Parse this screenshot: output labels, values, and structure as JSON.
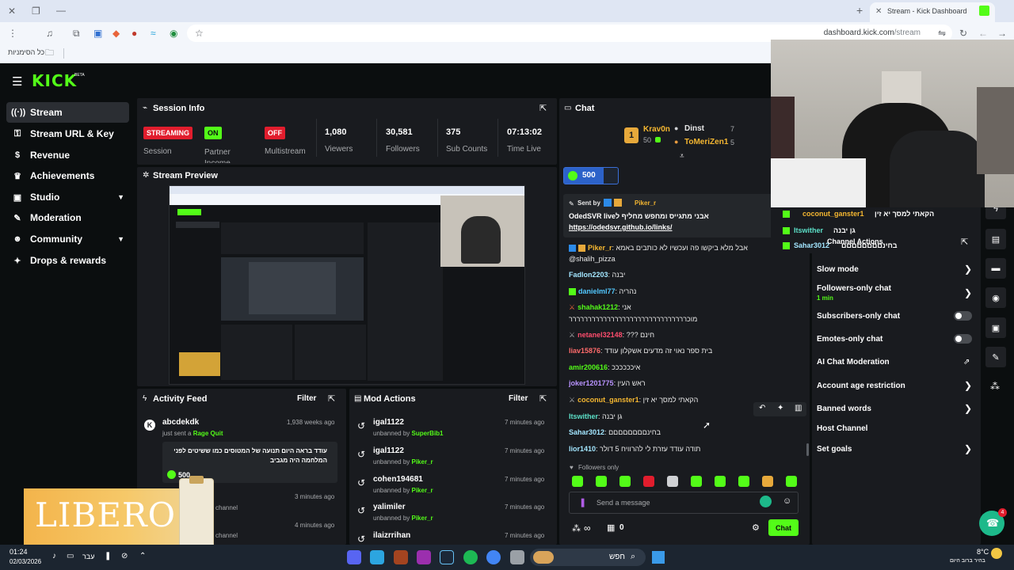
{
  "browser": {
    "tab_title": "Stream - Kick Dashboard",
    "address": "dashboard.kick.com/stream",
    "address_domain": "dashboard.kick.com",
    "address_path": "/stream",
    "bookmarks_label": "כל הסימניות"
  },
  "brand": {
    "logo": "KICK",
    "beta": "BETA",
    "accent": "#53fc18"
  },
  "sidebar": {
    "items": [
      {
        "label": "Stream",
        "icon": "broadcast-icon",
        "active": true
      },
      {
        "label": "Stream URL & Key",
        "icon": "key-icon"
      },
      {
        "label": "Revenue",
        "icon": "dollar-icon"
      },
      {
        "label": "Achievements",
        "icon": "trophy-icon"
      },
      {
        "label": "Studio",
        "icon": "camera-icon",
        "expandable": true
      },
      {
        "label": "Moderation",
        "icon": "wrench-icon"
      },
      {
        "label": "Community",
        "icon": "people-icon",
        "expandable": true
      },
      {
        "label": "Drops & rewards",
        "icon": "gift-icon"
      }
    ]
  },
  "session": {
    "title": "Session Info",
    "badges": [
      {
        "status": "STREAMING",
        "label": "Session"
      },
      {
        "status": "ON",
        "label": "Partner Income"
      },
      {
        "status": "OFF",
        "label": "Multistream"
      }
    ],
    "stats": [
      {
        "value": "1,080",
        "label": "Viewers"
      },
      {
        "value": "30,581",
        "label": "Followers"
      },
      {
        "value": "375",
        "label": "Sub Counts"
      },
      {
        "value": "07:13:02",
        "label": "Time Live"
      }
    ]
  },
  "preview": {
    "title": "Stream Preview"
  },
  "activity": {
    "title": "Activity Feed",
    "filter": "Filter",
    "items": [
      {
        "user": "abcdekdk",
        "time": "1,938 weeks ago",
        "action": "just sent a",
        "highlight": "Rage Quit",
        "message": "עודד בראה היום תנועה של המטוסים כמו ששיטים לפני המלחמה היה מגביב",
        "amount": "500"
      },
      {
        "time": "3 minutes ago",
        "text": "channel"
      },
      {
        "time": "4 minutes ago",
        "text": "channel"
      }
    ]
  },
  "mod_actions": {
    "title": "Mod Actions",
    "filter": "Filter",
    "items": [
      {
        "user": "igal1122",
        "action": "unbanned by",
        "by": "SuperBib1",
        "time": "7 minutes ago"
      },
      {
        "user": "igal1122",
        "action": "unbanned by",
        "by": "Piker_r",
        "time": "7 minutes ago"
      },
      {
        "user": "cohen194681",
        "action": "unbanned by",
        "by": "Piker_r",
        "time": "7 minutes ago"
      },
      {
        "user": "yalimiler",
        "action": "unbanned by",
        "by": "Piker_r",
        "time": "7 minutes ago"
      },
      {
        "user": "ilaizrrihan",
        "action": "",
        "by": "",
        "time": "7 minutes ago"
      }
    ]
  },
  "chat": {
    "title": "Chat",
    "leaders": [
      {
        "rank": "1",
        "name": "Krav0n",
        "count": "50"
      },
      {
        "name": "Dinst",
        "count": "7"
      },
      {
        "name": "ToMeriZen1",
        "count": "5"
      }
    ],
    "kicks": "500",
    "pinned": {
      "sent_by_label": "Sent by",
      "sender": "Piker_r",
      "text": "OdedSVR liveאבני מתגייס ומחפש מחליף ל",
      "link": "https://odedsvr.github.io/links/"
    },
    "messages": [
      {
        "user": "Piker_r",
        "text": "אבל מלא ביקשו פה ועכשיו לא כותבים באמא",
        "color": "#f5b731"
      },
      {
        "user": "",
        "text": "@shalih_pizza",
        "color": "#e8e8e8"
      },
      {
        "user": "Fadlon2203",
        "text": "יבנה",
        "color": "#a3e6ff"
      },
      {
        "user": "danielml77",
        "text": "נהריה",
        "color": "#52c8ff"
      },
      {
        "user": "shahak1212",
        "text": "אני",
        "color": "#53fc18"
      },
      {
        "user": "",
        "text": "מוכררררררררררררררררררררררררררררררר",
        "color": "#e8e8e8"
      },
      {
        "user": "netanel32148",
        "text": "??? חינם",
        "color": "#ff4d6d"
      },
      {
        "user": "liav15876",
        "text": "בית ספר נאוי זה מדעים אשקלון עודד",
        "color": "#ff6b6b"
      },
      {
        "user": "amir200616",
        "text": "איככככככ",
        "color": "#53fc18"
      },
      {
        "user": "joker1201775",
        "text": "ראש העין",
        "color": "#b993ff"
      },
      {
        "user": "coconut_ganster1",
        "text": "הקאתי למסך יא זין",
        "color": "#f5b731"
      },
      {
        "user": "Itswither",
        "text": "גן יבנה",
        "color": "#5ce0c8"
      },
      {
        "user": "Sahar3012",
        "text": "בחינםםםםםםםם",
        "color": "#a3e6ff"
      },
      {
        "user": "lior1410",
        "text": "תודה עודד עזרת לי להרוויח 5 דולר",
        "color": "#a3e6ff"
      }
    ],
    "mode_note": "Followers only",
    "placeholder": "Send a message",
    "footer_count": "0",
    "send_label": "Chat"
  },
  "channel_actions": {
    "title": "Channel Actions",
    "overlay": [
      {
        "user": "coconut_ganster1",
        "text": "הקאתי למסך יא זין"
      },
      {
        "user": "Itswither",
        "text": "גן יבנה"
      },
      {
        "user": "Sahar3012",
        "text": "בחינםםםםםםםם"
      }
    ],
    "rows": [
      {
        "label": "Slow mode",
        "control": "chevron"
      },
      {
        "label": "Followers-only chat",
        "sub": "1 min",
        "control": "chevron"
      },
      {
        "label": "Subscribers-only chat",
        "control": "toggle"
      },
      {
        "label": "Emotes-only chat",
        "control": "toggle"
      },
      {
        "label": "AI Chat Moderation",
        "control": "external"
      },
      {
        "label": "Account age restriction",
        "control": "chevron"
      },
      {
        "label": "Banned words",
        "control": "chevron"
      },
      {
        "label": "Host Channel",
        "control": "none"
      },
      {
        "label": "Set goals",
        "control": "chevron"
      }
    ]
  },
  "ad": {
    "brand": "LIBERO"
  },
  "taskbar": {
    "time": "01:24",
    "date": "02/03/2026",
    "lang": "עבר",
    "search": "חפש",
    "weather_temp": "8°C",
    "weather_text": "בהיר ברוב היום"
  }
}
